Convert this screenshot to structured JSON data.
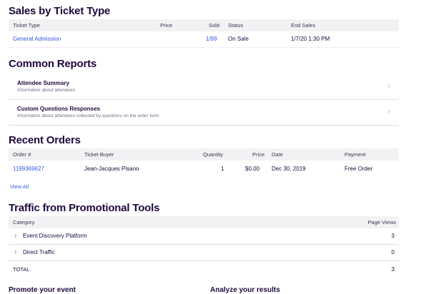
{
  "sales": {
    "title": "Sales by Ticket Type",
    "headers": {
      "ticket_type": "Ticket Type",
      "price": "Price",
      "sold": "Sold",
      "status": "Status",
      "end_sales": "End Sales"
    },
    "rows": [
      {
        "ticket_type": "General Admission",
        "price": "",
        "sold": "1/99",
        "status": "On Sale",
        "end_sales": "1/7/20 1:30 PM"
      }
    ]
  },
  "reports": {
    "title": "Common Reports",
    "items": [
      {
        "title": "Attendee Summary",
        "subtitle": "Information about attendees",
        "chevron": "›"
      },
      {
        "title": "Custom Questions Responses",
        "subtitle": "Information about attendees collected by questions on the order form",
        "chevron": "›"
      }
    ]
  },
  "orders": {
    "title": "Recent Orders",
    "headers": {
      "order": "Order #",
      "buyer": "Ticket Buyer",
      "quantity": "Quantity",
      "price": "Price",
      "date": "Date",
      "payment": "Payment"
    },
    "rows": [
      {
        "order": "1199369627",
        "buyer": "Jean-Jacques Pisano",
        "quantity": "1",
        "price": "$0.00",
        "date": "Dec 30, 2019",
        "payment": "Free Order"
      }
    ],
    "view_all": "View All"
  },
  "traffic": {
    "title": "Traffic from Promotional Tools",
    "headers": {
      "category": "Category",
      "page_views": "Page Views"
    },
    "rows": [
      {
        "chevron": "›",
        "category": "Event Discovery Platform",
        "views": "3"
      },
      {
        "chevron": "›",
        "category": "Direct Traffic",
        "views": "0"
      }
    ],
    "total": {
      "label": "TOTAL",
      "views": "3"
    }
  },
  "footer": {
    "promote": "Promote your event",
    "analyze": "Analyze your results"
  },
  "colors": {
    "link": "#3659e3",
    "heading": "#1e0a3c",
    "header_bg": "#f2f2f5"
  }
}
